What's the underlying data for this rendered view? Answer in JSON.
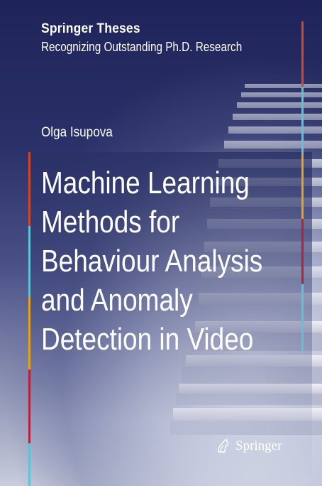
{
  "series": {
    "title": "Springer Theses",
    "subtitle": "Recognizing Outstanding Ph.D. Research"
  },
  "author": "Olga Isupova",
  "book_title_lines": [
    "Machine Learning",
    "Methods for",
    "Behaviour Analysis",
    "and Anomaly",
    "Detection in Video"
  ],
  "publisher": {
    "name": "Springer",
    "logo_icon": "springer-horse-icon"
  },
  "colors": {
    "background_dark": "#1e2459",
    "text": "#ffffff",
    "stripe_orange": "#d2462a",
    "stripe_cyan": "#5ec3d6",
    "stripe_yellow": "#e6a21e",
    "stripe_red": "#b3223a"
  }
}
